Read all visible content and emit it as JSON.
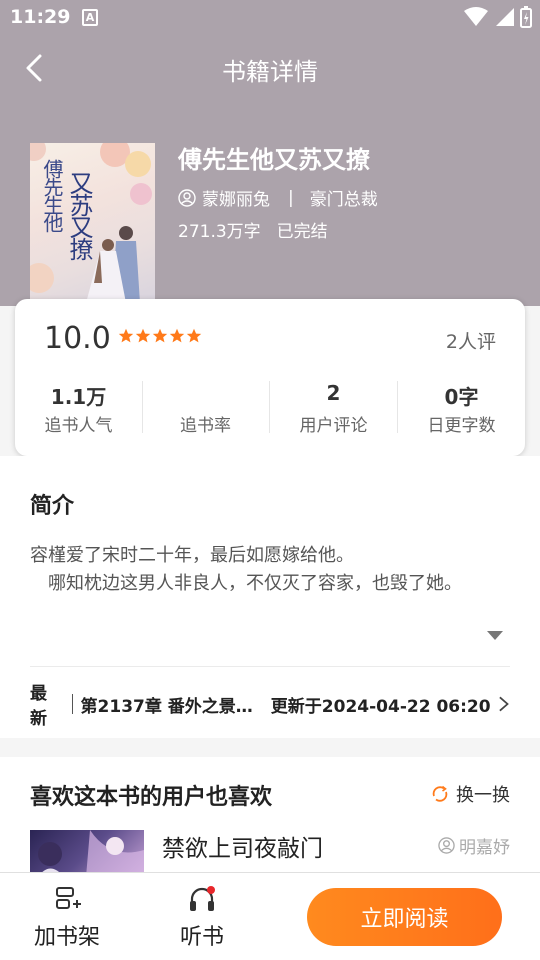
{
  "status_bar": {
    "time": "11:29",
    "a_icon_letter": "A"
  },
  "nav": {
    "title": "书籍详情",
    "back_icon": "chevron-left-icon"
  },
  "book": {
    "cover": {
      "title_col1": "傅先生他",
      "title_col2": "又苏又撩"
    },
    "title": "傅先生他又苏又撩",
    "author": "蒙娜丽兔",
    "separator": "|",
    "category": "豪门总裁",
    "word_count": "271.3万字",
    "status": "已完结"
  },
  "rating": {
    "score": "10.0",
    "stars": 5,
    "star_color": "#ff7a1a",
    "count_label": "2人评",
    "metrics": [
      {
        "value": "1.1万",
        "label": "追书人气"
      },
      {
        "value": "",
        "label": "追书率"
      },
      {
        "value": "2",
        "label": "用户评论"
      },
      {
        "value": "0字",
        "label": "日更字数"
      }
    ]
  },
  "intro": {
    "title": "简介",
    "text": "容槿爱了宋时二十年，最后如愿嫁给他。\n　哪知枕边这男人非良人，不仅灭了容家，也毁了她。",
    "expand_icon": "triangle-down-icon"
  },
  "latest": {
    "label": "最新",
    "chapter": "第2137章 番外之景…",
    "update": "更新于2024-04-22 06:20"
  },
  "recommend": {
    "title": "喜欢这本书的用户也喜欢",
    "refresh_label": "换一换",
    "items": [
      {
        "title": "禁欲上司夜敲门",
        "author": "明嘉妤"
      }
    ]
  },
  "bottom_bar": {
    "shelf_label": "加书架",
    "listen_label": "听书",
    "read_label": "立即阅读",
    "accent_color": "#ff7a1a"
  }
}
